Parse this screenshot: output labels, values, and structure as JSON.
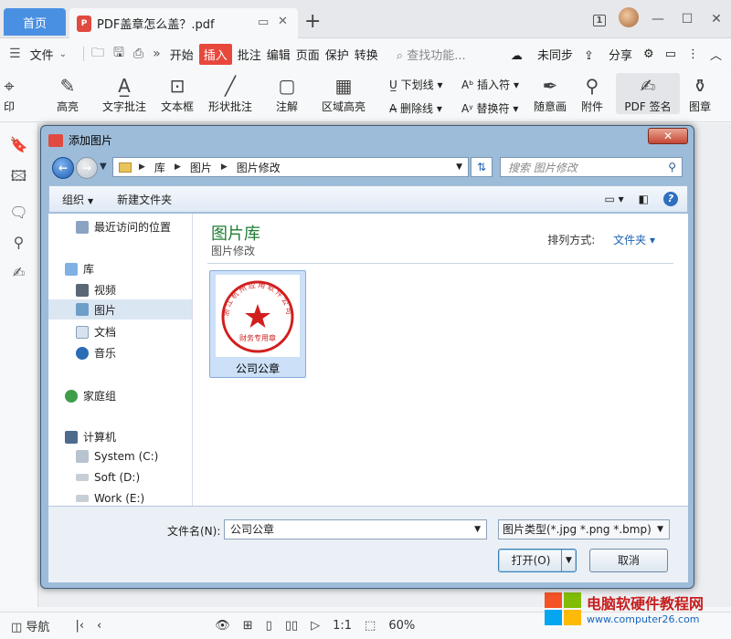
{
  "tabs": {
    "home": "首页",
    "doc_title": "PDF盖章怎么盖？.pdf",
    "page_count_badge": "1"
  },
  "menubar": {
    "file": "文件",
    "items": [
      "开始",
      "插入",
      "批注",
      "编辑",
      "页面",
      "保护",
      "转换"
    ],
    "active_item": "插入",
    "search_placeholder": "查找功能...",
    "sync": "未同步",
    "share": "分享"
  },
  "ribbon": {
    "print_label": "印",
    "highlight": "高亮",
    "text_annot": "文字批注",
    "textbox": "文本框",
    "shape_annot": "形状批注",
    "note": "注解",
    "area_highlight": "区域高亮",
    "underline": "下划线",
    "strikeout": "删除线",
    "insert_char": "插入符",
    "replace_char": "替换符",
    "freehand": "随意画",
    "attach": "附件",
    "pdf_sign": "PDF 签名",
    "stamp": "图章"
  },
  "statusbar": {
    "nav": "导航",
    "zoom": "60%"
  },
  "watermark": {
    "title": "电脑软硬件教程网",
    "url": "www.computer26.com"
  },
  "dialog": {
    "title": "添加图片",
    "breadcrumb": [
      "库",
      "图片",
      "图片修改"
    ],
    "search_placeholder": "搜索 图片修改",
    "toolbar": {
      "organize": "组织",
      "new_folder": "新建文件夹"
    },
    "tree": [
      {
        "label": "最近访问的位置",
        "icon": "recent-icon"
      },
      {
        "label": "库",
        "icon": "library-icon"
      },
      {
        "label": "视频",
        "icon": "video-icon"
      },
      {
        "label": "图片",
        "icon": "pictures-icon",
        "selected": true
      },
      {
        "label": "文档",
        "icon": "documents-icon"
      },
      {
        "label": "音乐",
        "icon": "music-icon"
      },
      {
        "label": "家庭组",
        "icon": "homegroup-icon"
      },
      {
        "label": "计算机",
        "icon": "computer-icon"
      },
      {
        "label": "System (C:)",
        "icon": "drive-icon"
      },
      {
        "label": "Soft (D:)",
        "icon": "drive-icon"
      },
      {
        "label": "Work (E:)",
        "icon": "drive-icon"
      }
    ],
    "library": {
      "title": "图片库",
      "subtitle": "图片修改",
      "sort_label": "排列方式:",
      "sort_value": "文件夹"
    },
    "files": [
      {
        "label": "公司公章",
        "seal_text": "浙江杭州应用软件公司",
        "seal_bottom": "财务专用章"
      }
    ],
    "filename_label": "文件名(N):",
    "filename_value": "公司公章",
    "filetype_value": "图片类型(*.jpg *.png *.bmp)",
    "open_button": "打开(O)",
    "cancel_button": "取消"
  }
}
